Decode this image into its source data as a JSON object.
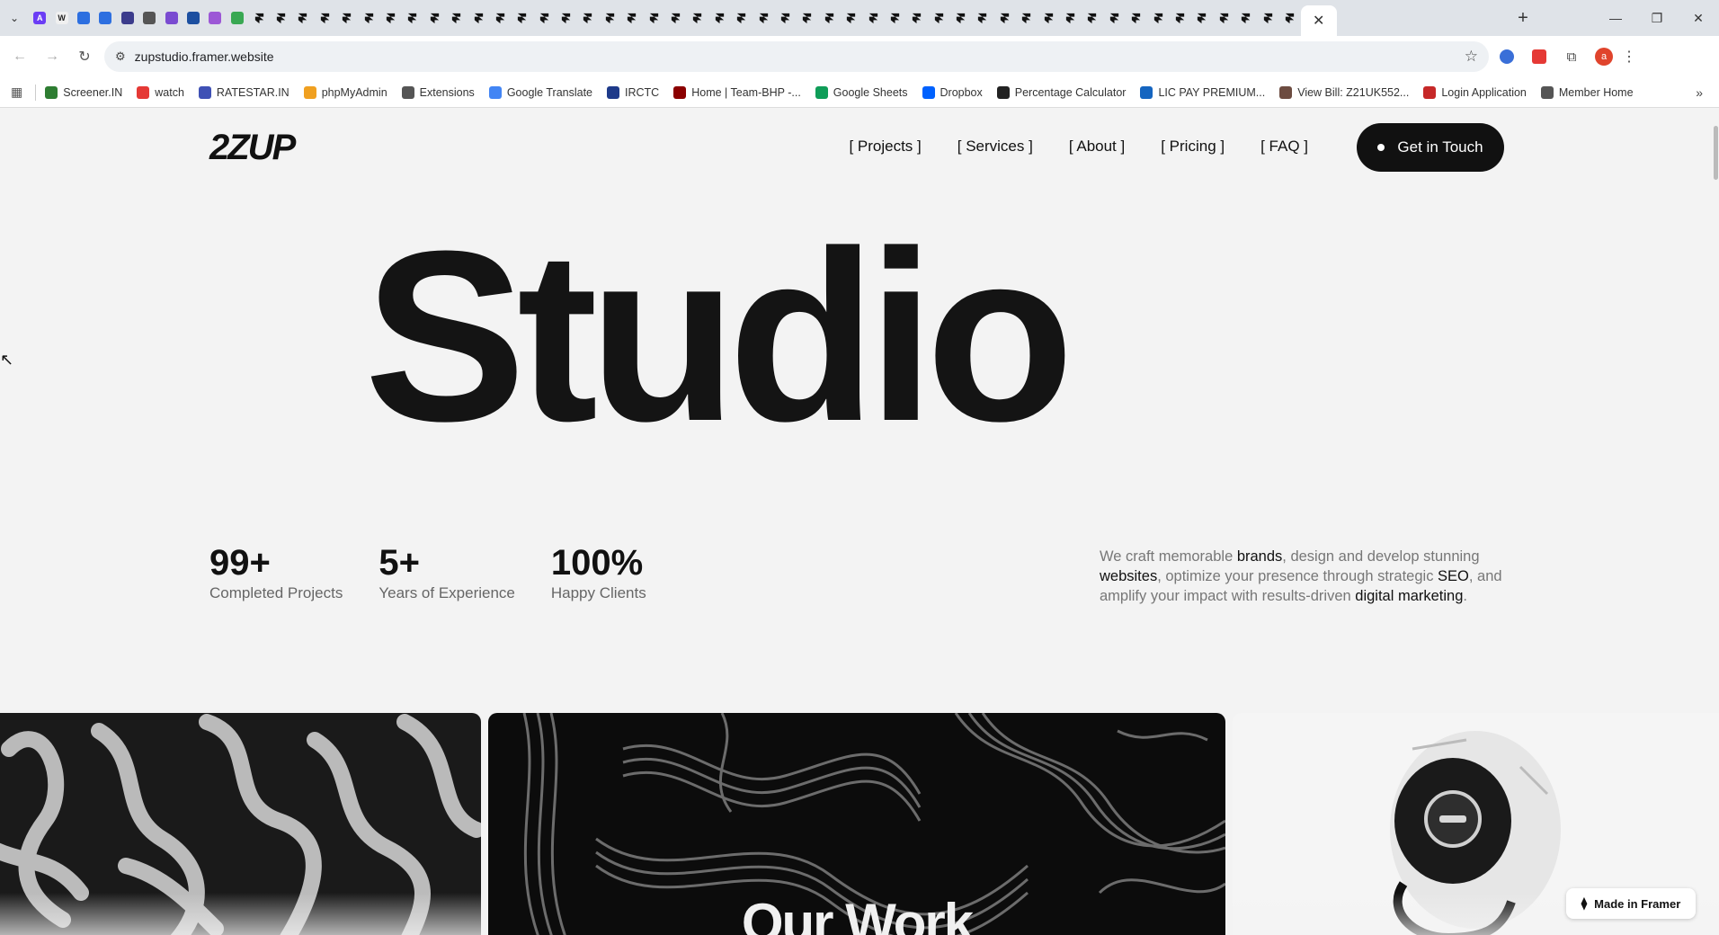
{
  "browser": {
    "tabs": {
      "search_icon": "chevron-down-icon",
      "pinned": [
        {
          "icon": "app-icon",
          "color": "#6b3df5",
          "glyph": "A"
        },
        {
          "icon": "wix-icon",
          "color": "#f0f0f0",
          "glyph": "W"
        },
        {
          "icon": "app-icon",
          "color": "#2d6fe0",
          "glyph": ""
        },
        {
          "icon": "app-icon",
          "color": "#2d6fe0",
          "glyph": ""
        },
        {
          "icon": "app-icon",
          "color": "#3c3c8c",
          "glyph": ""
        },
        {
          "icon": "app-icon",
          "color": "#555555",
          "glyph": ""
        },
        {
          "icon": "app-icon",
          "color": "#7a4bd1",
          "glyph": ""
        },
        {
          "icon": "app-icon",
          "color": "#1c4fa0",
          "glyph": ""
        },
        {
          "icon": "app-icon",
          "color": "#9c57d6",
          "glyph": ""
        },
        {
          "icon": "app-icon",
          "color": "#39a853",
          "glyph": ""
        }
      ],
      "framer_tab_count": 48,
      "close_glyph": "✕",
      "new_tab_glyph": "+"
    },
    "window": {
      "minimize": "—",
      "restore": "❐",
      "close": "✕"
    },
    "url": "zupstudio.framer.website",
    "profile_initial": "a",
    "bookmarks": [
      {
        "label": "Screener.IN",
        "color": "#2e7d32"
      },
      {
        "label": "watch",
        "color": "#e53935"
      },
      {
        "label": "RATESTAR.IN",
        "color": "#3f51b5"
      },
      {
        "label": "phpMyAdmin",
        "color": "#f0a020"
      },
      {
        "label": "Extensions",
        "color": "#555555"
      },
      {
        "label": "Google Translate",
        "color": "#4285f4"
      },
      {
        "label": "IRCTC",
        "color": "#1e3a8a"
      },
      {
        "label": "Home | Team-BHP -...",
        "color": "#8b0000"
      },
      {
        "label": "Google Sheets",
        "color": "#0f9d58"
      },
      {
        "label": "Dropbox",
        "color": "#0061fe"
      },
      {
        "label": "Percentage Calculator",
        "color": "#222222"
      },
      {
        "label": "LIC PAY PREMIUM...",
        "color": "#1565c0"
      },
      {
        "label": "View Bill: Z21UK552...",
        "color": "#6d4c41"
      },
      {
        "label": "Login Application",
        "color": "#c62828"
      },
      {
        "label": "Member Home",
        "color": "#555555"
      }
    ]
  },
  "site": {
    "logo": "2ZUP",
    "nav": [
      "[ Projects ]",
      "[ Services ]",
      "[ About ]",
      "[ Pricing ]",
      "[ FAQ ]"
    ],
    "cta": "Get in Touch",
    "hero": "Studio",
    "stats": [
      {
        "value": "99+",
        "label": "Completed Projects"
      },
      {
        "value": "5+",
        "label": "Years of Experience"
      },
      {
        "value": "100%",
        "label": "Happy Clients"
      }
    ],
    "blurb": {
      "p1": "We craft memorable ",
      "b1": "brands",
      "p2": ", design and develop stunning ",
      "b2": "websites",
      "p3": ", optimize your presence through strategic ",
      "b3": "SEO",
      "p4": ", and amplify your impact with results-driven ",
      "b4": "digital marketing",
      "p5": "."
    },
    "gallery_title": "Our Work",
    "badge": "Made in Framer"
  }
}
